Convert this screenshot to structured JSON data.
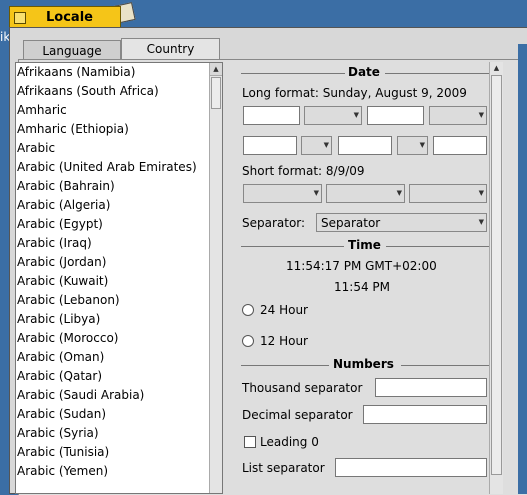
{
  "window": {
    "title": "Locale"
  },
  "desktop": {
    "icon_text": "ik"
  },
  "tabs": [
    "Language",
    "Country"
  ],
  "countries": [
    "Afrikaans (Namibia)",
    "Afrikaans (South Africa)",
    "Amharic",
    "Amharic (Ethiopia)",
    "Arabic",
    "Arabic (United Arab Emirates)",
    "Arabic (Bahrain)",
    "Arabic (Algeria)",
    "Arabic (Egypt)",
    "Arabic (Iraq)",
    "Arabic (Jordan)",
    "Arabic (Kuwait)",
    "Arabic (Lebanon)",
    "Arabic (Libya)",
    "Arabic (Morocco)",
    "Arabic (Oman)",
    "Arabic (Qatar)",
    "Arabic (Saudi Arabia)",
    "Arabic (Sudan)",
    "Arabic (Syria)",
    "Arabic (Tunisia)",
    "Arabic (Yemen)"
  ],
  "date": {
    "header": "Date",
    "long_format": "Long format: Sunday, August 9, 2009",
    "short_format": "Short format: 8/9/09",
    "separator_label": "Separator:",
    "separator_value": "Separator"
  },
  "time": {
    "header": "Time",
    "long": "11:54:17 PM GMT+02:00",
    "short": "11:54 PM",
    "option_24": "24 Hour",
    "option_12": "12 Hour"
  },
  "numbers": {
    "header": "Numbers",
    "thousand_label": "Thousand separator",
    "thousand_value": "",
    "decimal_label": "Decimal separator",
    "decimal_value": "",
    "leading_zero_label": "Leading 0",
    "list_label": "List separator",
    "list_value": ""
  }
}
